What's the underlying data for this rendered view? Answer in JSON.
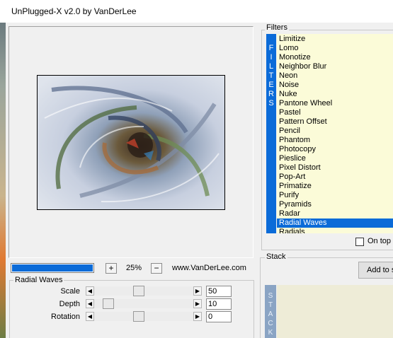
{
  "window": {
    "title": "UnPlugged-X v2.0 by VanDerLee"
  },
  "preview": {
    "zoom": "25%",
    "zoom_in": "+",
    "zoom_out": "−",
    "website": "www.VanDerLee.com",
    "progress_fraction": 1.0
  },
  "effect": {
    "name": "Radial Waves",
    "params": [
      {
        "label": "Scale",
        "value": "50",
        "slider_fraction": 0.44
      },
      {
        "label": "Depth",
        "value": "10",
        "slider_fraction": 0.1
      },
      {
        "label": "Rotation",
        "value": "0",
        "slider_fraction": 0.44
      }
    ]
  },
  "filters": {
    "title": "Filters",
    "side_label": [
      "F",
      "I",
      "L",
      "T",
      "E",
      "R",
      "S"
    ],
    "items": [
      "Limitize",
      "Lomo",
      "Monotize",
      "Neighbor Blur",
      "Neon",
      "Noise",
      "Nuke",
      "Pantone Wheel",
      "Pastel",
      "Pattern Offset",
      "Pencil",
      "Phantom",
      "Photocopy",
      "Pieslice",
      "Pixel Distort",
      "Pop-Art",
      "Primatize",
      "Purify",
      "Pyramids",
      "Radar",
      "Radial Waves",
      "Radials"
    ],
    "selected": "Radial Waves",
    "on_top_label": "On top",
    "on_top_checked": false
  },
  "stack": {
    "title": "Stack",
    "add_label": "Add to s",
    "side_label": [
      "S",
      "T",
      "A",
      "C",
      "K"
    ]
  },
  "colors": {
    "accent": "#0b6bd8",
    "list_bg": "#fbfbd8",
    "stack_bg": "#eeecd7"
  }
}
